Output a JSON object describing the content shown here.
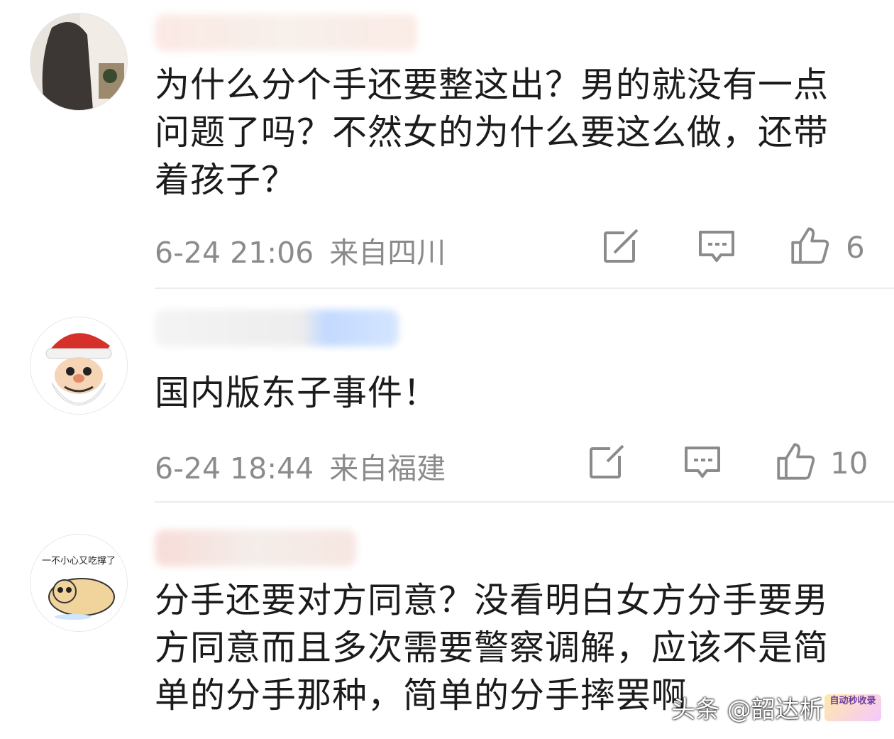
{
  "comments": [
    {
      "text": "为什么分个手还要整这出？男的就没有一点问题了吗？不然女的为什么要这么做，还带着孩子？",
      "time": "6-24 21:06",
      "location": "来自四川",
      "likes": "6"
    },
    {
      "text": "国内版东子事件！",
      "time": "6-24 18:44",
      "location": "来自福建",
      "likes": "10"
    },
    {
      "avatar_caption": "一不小心又吃撑了",
      "text": "分手还要对方同意？没看明白女方分手要男方同意而且多次需要警察调解，应该不是简单的分手那种，简单的分手摔罢啊"
    }
  ],
  "watermark": {
    "text": "头条 @韶达析",
    "logo_text": "自动秒收录"
  },
  "icons": [
    "share-icon",
    "comment-icon",
    "like-icon"
  ],
  "colors": {
    "meta": "#8b8b8b",
    "text": "#1b1b1b",
    "divider": "#ececec"
  }
}
